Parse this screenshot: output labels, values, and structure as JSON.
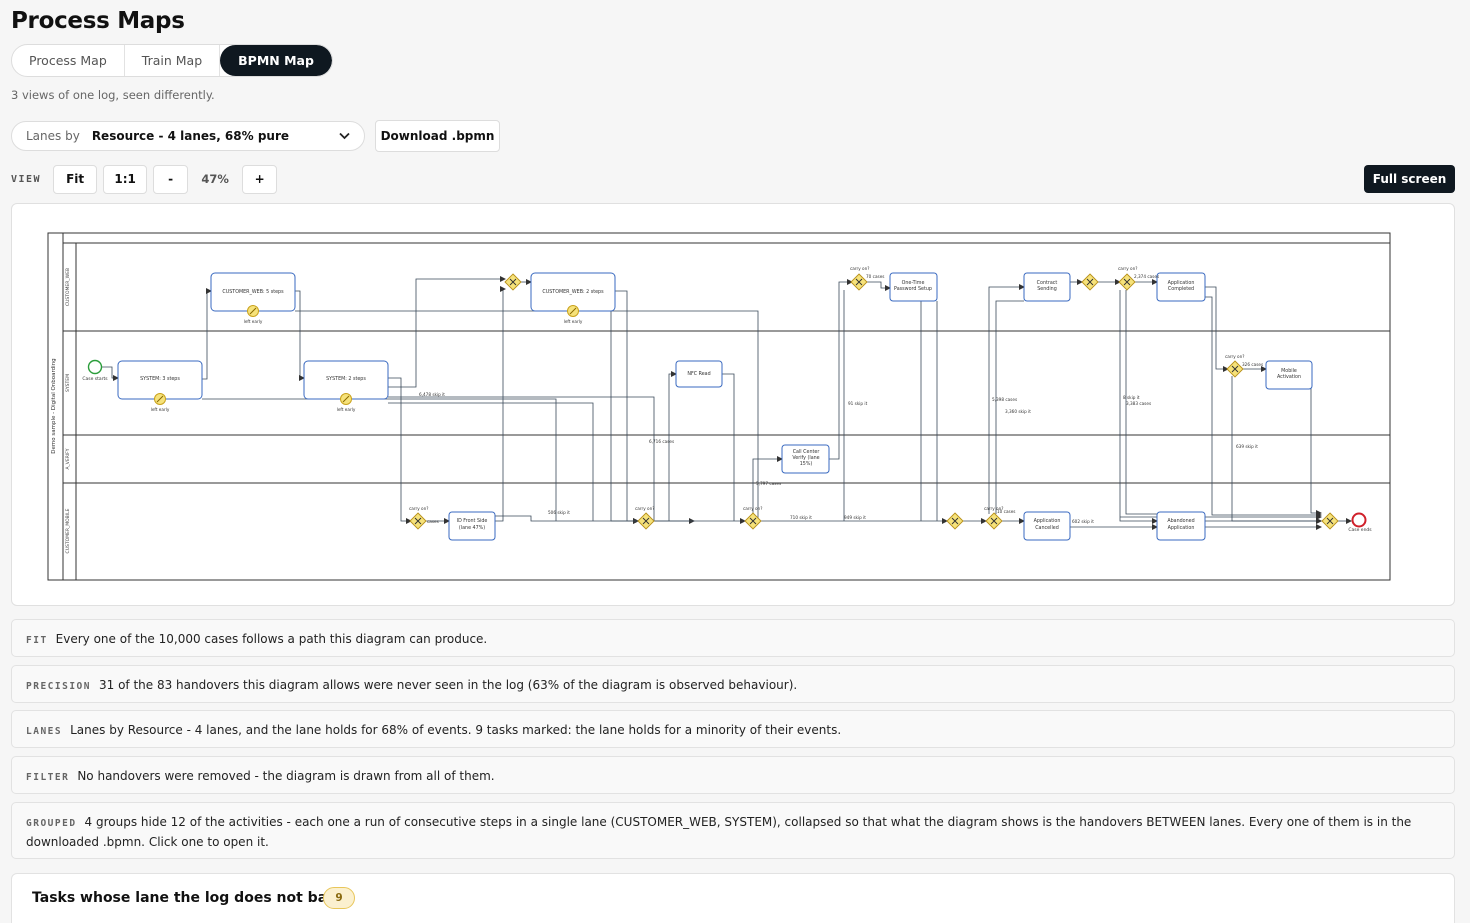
{
  "page": {
    "title": "Process Maps",
    "subtitle": "3 views of one log, seen differently."
  },
  "tabs": [
    {
      "label": "Process Map",
      "active": false
    },
    {
      "label": "Train Map",
      "active": false
    },
    {
      "label": "BPMN Map",
      "active": true
    }
  ],
  "lanes_select": {
    "label": "Lanes by",
    "value": "Resource - 4 lanes, 68% pure"
  },
  "download_label": "Download .bpmn",
  "view": {
    "label": "VIEW",
    "fit": "Fit",
    "one_to_one": "1:1",
    "minus": "-",
    "zoom": "47%",
    "plus": "+",
    "fullscreen": "Full screen"
  },
  "diagram": {
    "pool_label": "Demo sample - Digital Onboarding",
    "lanes": [
      "CUSTOMER_WEB",
      "SYSTEM",
      "A_VERIFY",
      "CUSTOMER_MOBILE"
    ],
    "tasks": {
      "cw5": "CUSTOMER_WEB: 5 steps",
      "cw2": "CUSTOMER_WEB: 2 steps",
      "otp": [
        "One-Time",
        "Password Setup"
      ],
      "contract": [
        "Contract",
        "Sending"
      ],
      "appcomplete": [
        "Application",
        "Completed"
      ],
      "sys3": "SYSTEM: 3 steps",
      "sys2": "SYSTEM: 2 steps",
      "nfc": "NFC Read",
      "mobile": [
        "Mobile",
        "Activation"
      ],
      "callcenter": [
        "Call Center",
        "Verify (lane",
        "15%)"
      ],
      "idfront": [
        "ID Front Side",
        "(lane 47%)"
      ],
      "appcancel": [
        "Application",
        "Cancelled"
      ],
      "abandoned": [
        "Abandoned",
        "Application"
      ]
    },
    "texts": {
      "case_starts": "Case starts",
      "case_ends": "Case ends",
      "left_early": "left early",
      "carry_on": "carry on?",
      "e_6478": "6,478 skip it",
      "e_6716": "6,716 cases",
      "e_5797": "5,797 cases",
      "e_506": "506 skip it",
      "e_710": "710 skip it",
      "e_949": "949 skip it",
      "e_91": "91 skip it",
      "e_70cases": "70 cases",
      "e_5398": "5,398 cases",
      "e_3360": "3,360 skip it",
      "e_8": "8 skip it",
      "e_3383": "3,383 cases",
      "e_2374": "2,374 cases",
      "e_326": "326 cases",
      "e_639": "639 skip it",
      "e_602": "602 skip it",
      "e_cases": "cases",
      "e_10": "10 cases"
    }
  },
  "info": {
    "fit_key": "FIT",
    "fit_text": "Every one of the 10,000 cases follows a path this diagram can produce.",
    "precision_key": "PRECISION",
    "precision_text": "31 of the 83 handovers this diagram allows were never seen in the log (63% of the diagram is observed behaviour).",
    "lanes_key": "LANES",
    "lanes_text": "Lanes by Resource - 4 lanes, and the lane holds for 68% of events. 9 tasks marked: the lane holds for a minority of their events.",
    "filter_key": "FILTER",
    "filter_text": "No handovers were removed - the diagram is drawn from all of them.",
    "grouped_key": "GROUPED",
    "grouped_text": "4 groups hide 12 of the activities - each one a run of consecutive steps in a single lane (CUSTOMER_WEB, SYSTEM), collapsed so that what the diagram shows is the handovers BETWEEN lanes. Every one of them is in the downloaded .bpmn. Click one to open it."
  },
  "tasks_card": {
    "title": "Tasks whose lane the log does not back",
    "count": "9"
  }
}
